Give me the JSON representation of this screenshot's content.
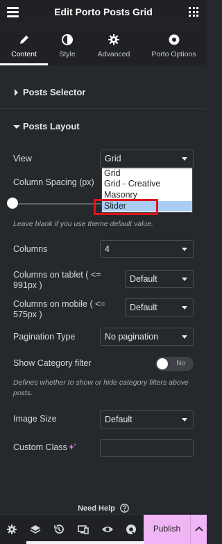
{
  "header": {
    "title": "Edit Porto Posts Grid"
  },
  "tabs": [
    {
      "label": "Content",
      "icon": "pencil-icon",
      "active": true
    },
    {
      "label": "Style",
      "icon": "contrast-icon"
    },
    {
      "label": "Advanced",
      "icon": "gear-icon"
    },
    {
      "label": "Porto Options",
      "icon": "porto-icon"
    }
  ],
  "sections": {
    "posts_selector": "Posts Selector",
    "posts_layout": "Posts Layout"
  },
  "controls": {
    "view": {
      "label": "View",
      "value": "Grid",
      "options": [
        "Grid",
        "Grid - Creative",
        "Masonry",
        "Slider"
      ],
      "highlighted": "Slider"
    },
    "column_spacing": {
      "label": "Column Spacing (px)",
      "hint": "Leave blank if you use theme default value."
    },
    "columns": {
      "label": "Columns",
      "value": "4"
    },
    "columns_tablet": {
      "label": "Columns on tablet ( <= 991px )",
      "value": "Default"
    },
    "columns_mobile": {
      "label": "Columns on mobile ( <= 575px )",
      "value": "Default"
    },
    "pagination_type": {
      "label": "Pagination Type",
      "value": "No pagination"
    },
    "show_category_filter": {
      "label": "Show Category filter",
      "toggle_text": "No",
      "hint": "Defines whether to show or hide category filters above posts."
    },
    "image_size": {
      "label": "Image Size",
      "value": "Default"
    },
    "custom_class": {
      "label": "Custom Class",
      "value": ""
    }
  },
  "footer": {
    "need_help": "Need Help",
    "publish": "Publish"
  },
  "colors": {
    "accent_publish": "#f0b5f5",
    "panel_bg": "#26292c",
    "header_bg": "#1f2124",
    "highlight_box": "#e0141c"
  }
}
